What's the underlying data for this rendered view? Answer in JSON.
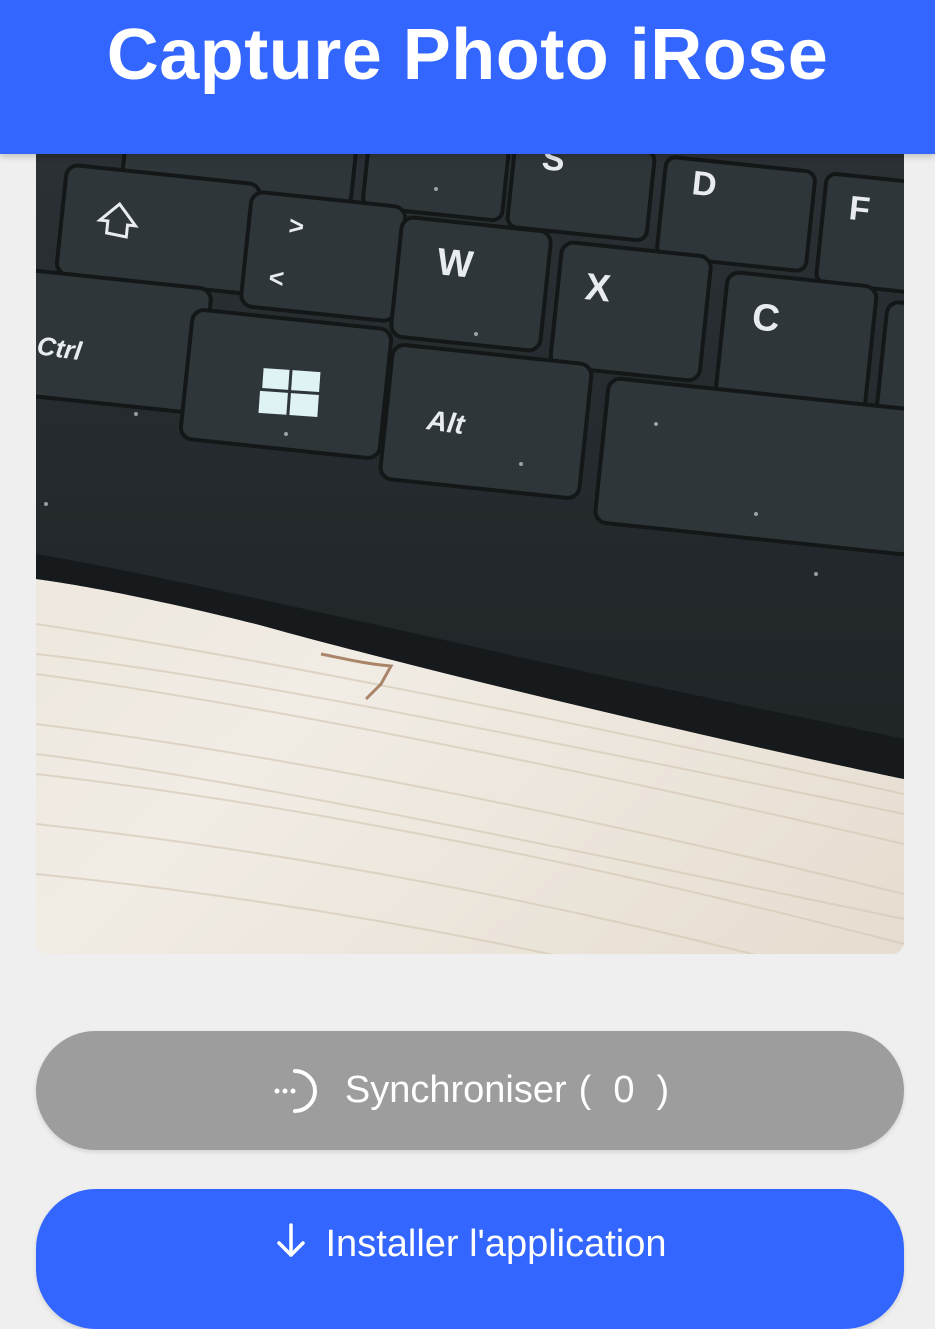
{
  "header": {
    "title": "Capture Photo iRose"
  },
  "preview": {
    "image_alt": "photo preview",
    "keys": [
      "S",
      "D",
      "F",
      "W",
      "X",
      "C",
      "Ctrl",
      "Alt",
      ">",
      "<"
    ]
  },
  "sync_button": {
    "label": "Synchroniser",
    "count_open": "(",
    "count": "0",
    "count_close": ")"
  },
  "install_button": {
    "label": "Installer l'application"
  },
  "colors": {
    "primary": "#3366ff",
    "sync_bg": "#9d9d9d",
    "page_bg": "#efefef"
  }
}
